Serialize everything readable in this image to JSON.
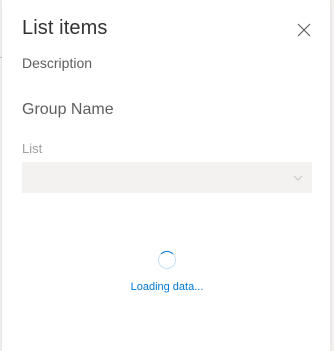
{
  "panel": {
    "title": "List items",
    "description": "Description",
    "group_name": "Group Name",
    "list_label": "List",
    "list_value": "",
    "close_icon": "close-icon",
    "chevron_icon": "chevron-down-icon"
  },
  "loading": {
    "text": "Loading data..."
  },
  "colors": {
    "accent": "#0078d4",
    "text": "#323130",
    "muted": "#605e5c",
    "disabled": "#a19f9d",
    "field_bg": "#f3f2f1"
  }
}
